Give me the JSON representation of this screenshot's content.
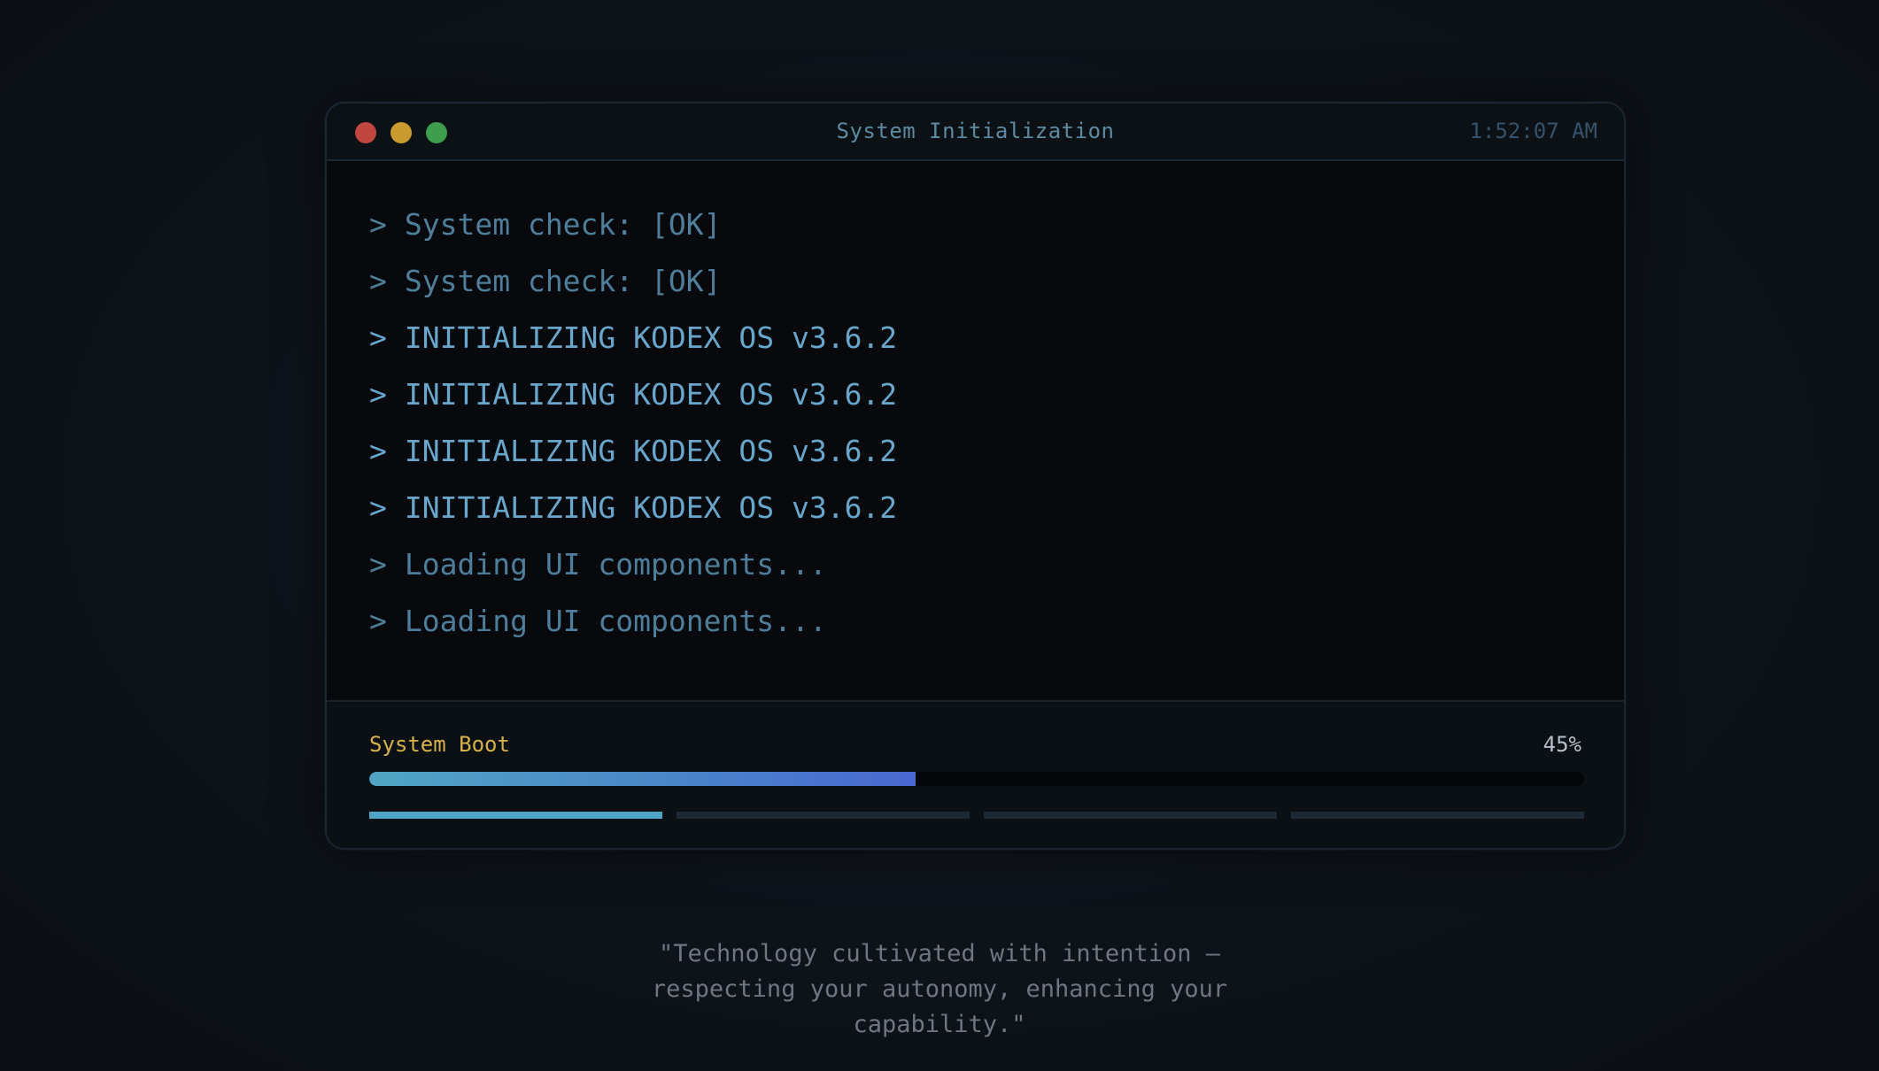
{
  "window": {
    "title": "System Initialization",
    "clock": "1:52:07 AM",
    "controls": {
      "close_color": "#c0463f",
      "minimize_color": "#c99a2e",
      "maximize_color": "#3f9d4e"
    }
  },
  "console": {
    "prompt": ">",
    "lines": [
      {
        "text": "System check: [OK]",
        "tone": "dim"
      },
      {
        "text": "System check: [OK]",
        "tone": "dim"
      },
      {
        "text": "INITIALIZING KODEX OS v3.6.2",
        "tone": "bright"
      },
      {
        "text": "INITIALIZING KODEX OS v3.6.2",
        "tone": "bright"
      },
      {
        "text": "INITIALIZING KODEX OS v3.6.2",
        "tone": "bright"
      },
      {
        "text": "INITIALIZING KODEX OS v3.6.2",
        "tone": "bright"
      },
      {
        "text": "Loading UI components...",
        "tone": "dim"
      },
      {
        "text": "Loading UI components...",
        "tone": "dim"
      }
    ]
  },
  "boot": {
    "label": "System Boot",
    "percent_text": "45%",
    "progress": 0.45,
    "stages_total": 4,
    "stages_complete": 1,
    "colors": {
      "label": "#d7b14a",
      "stage_done": "#4fa6c4",
      "stage_pending": "#1d2a35"
    }
  },
  "quote": {
    "text": "\"Technology cultivated with intention — respecting your autonomy, enhancing your capability.\""
  }
}
